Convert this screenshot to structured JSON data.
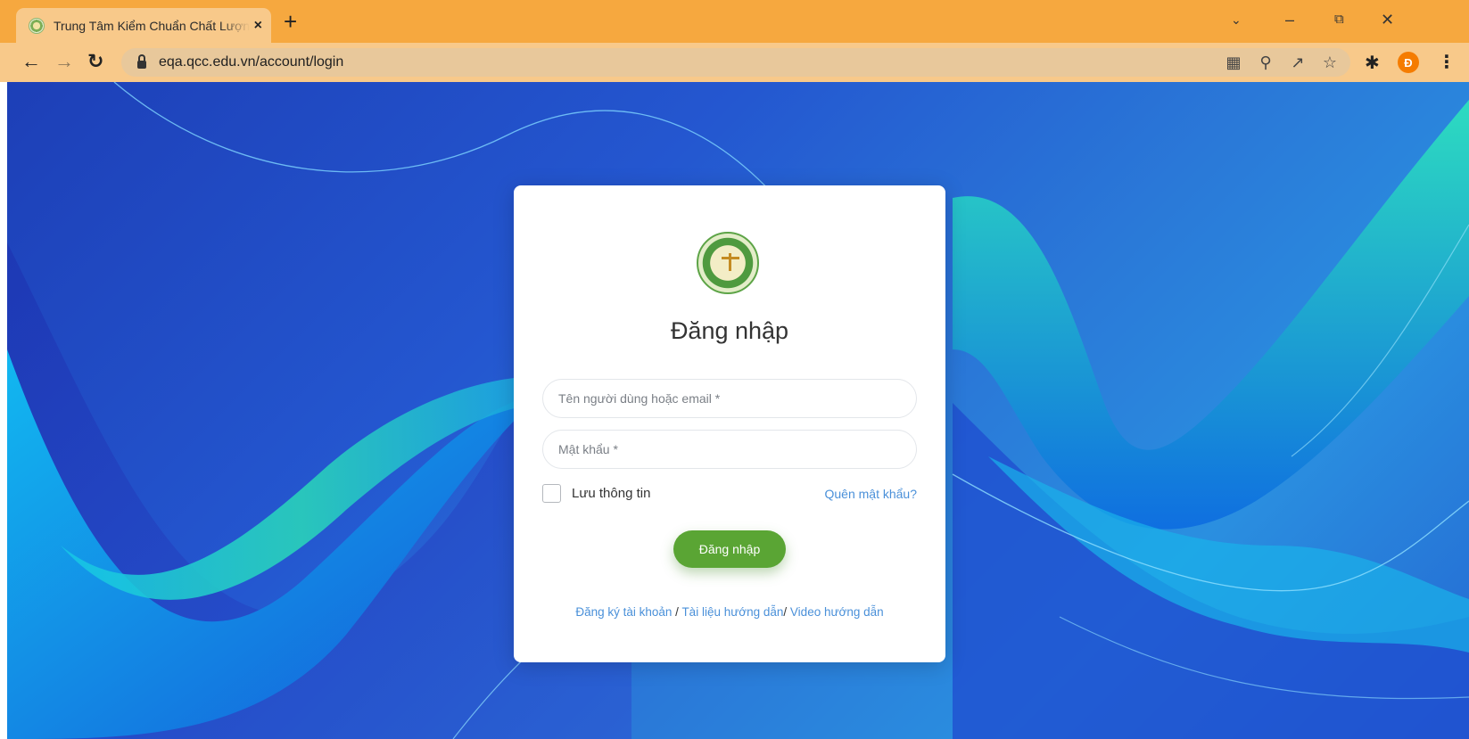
{
  "browser": {
    "tab_title": "Trung Tâm Kiểm Chuẩn Chất Lượng",
    "tab_close": "×",
    "new_tab": "+",
    "url": "eqa.qcc.edu.vn/account/login",
    "profile_initial": "Đ"
  },
  "icons": {
    "back": "back-arrow-icon",
    "forward": "forward-arrow-icon",
    "reload": "reload-icon",
    "lock": "lock-icon",
    "translate": "translate-icon",
    "zoom": "zoom-icon",
    "share": "share-icon",
    "bookmark": "star-icon",
    "extensions": "puzzle-icon",
    "menu": "kebab-menu-icon"
  },
  "colors": {
    "titlebar": "#f6a83f",
    "toolbar": "#f8c98a",
    "primary_button": "#5aa534",
    "link": "#4a90d9"
  },
  "login": {
    "title": "Đăng nhập",
    "username_placeholder": "Tên người dùng hoặc email *",
    "password_placeholder": "Mật khẩu *",
    "remember_label": "Lưu thông tin",
    "forgot_label": "Quên mật khẩu?",
    "submit_label": "Đăng nhập",
    "links": {
      "register": "Đăng ký tài khoản",
      "sep1": " / ",
      "docs": "Tài liệu hướng dẫn",
      "sep2": "/ ",
      "video": "Video hướng dẫn"
    }
  }
}
